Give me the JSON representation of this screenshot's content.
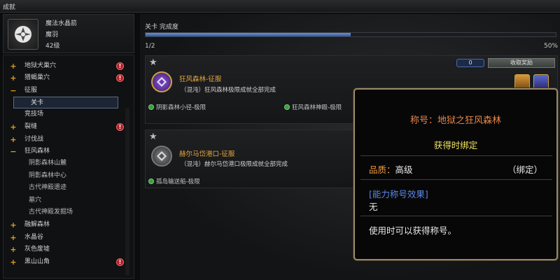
{
  "window": {
    "title": "成就"
  },
  "profile": {
    "name": "魔法水晶箭",
    "title": "魔羽",
    "level": "42级"
  },
  "tree": {
    "items": [
      {
        "label": "地狱犬巢穴",
        "marker": "+",
        "alert": true,
        "kind": "group"
      },
      {
        "label": "猎蝎巢穴",
        "marker": "+",
        "alert": true,
        "kind": "group"
      },
      {
        "label": "征服",
        "marker": "−",
        "alert": false,
        "kind": "group"
      },
      {
        "label": "关卡",
        "marker": "",
        "alert": false,
        "kind": "selected"
      },
      {
        "label": "竞技场",
        "marker": "",
        "alert": false,
        "kind": "group"
      },
      {
        "label": "裂缝",
        "marker": "+",
        "alert": true,
        "kind": "group"
      },
      {
        "label": "讨伐战",
        "marker": "+",
        "alert": false,
        "kind": "group"
      },
      {
        "label": "狂风森林",
        "marker": "−",
        "alert": false,
        "kind": "group"
      },
      {
        "label": "阴影森林山麓",
        "marker": "",
        "alert": false,
        "kind": "child"
      },
      {
        "label": "阴影森林中心",
        "marker": "",
        "alert": false,
        "kind": "child"
      },
      {
        "label": "古代神殿遗迹",
        "marker": "",
        "alert": false,
        "kind": "child"
      },
      {
        "label": "墓穴",
        "marker": "",
        "alert": false,
        "kind": "child"
      },
      {
        "label": "古代神殿发掘场",
        "marker": "",
        "alert": false,
        "kind": "child"
      },
      {
        "label": "融解森林",
        "marker": "+",
        "alert": false,
        "kind": "group"
      },
      {
        "label": "水晶谷",
        "marker": "+",
        "alert": false,
        "kind": "group"
      },
      {
        "label": "灰色废墟",
        "marker": "+",
        "alert": false,
        "kind": "group"
      },
      {
        "label": "黑山山角",
        "marker": "+",
        "alert": true,
        "kind": "group"
      }
    ],
    "alert_glyph": "!"
  },
  "progress": {
    "label": "关卡 完成度",
    "count": "1/2",
    "percent_text": "50%",
    "fraction": 0.5
  },
  "cards": [
    {
      "title": "狂风森林-征服",
      "desc": "（混沌）狂风森林极限成就全部完成",
      "subitems": [
        "阴影森林小径-极限",
        "狂风森林神殿-极限"
      ],
      "count": "0",
      "claim_label": "收取奖励",
      "icon": "purple-emblem-icon"
    },
    {
      "title": "赫尔马岱港口-征服",
      "desc": "（混沌）赫尔马岱港口极限成就全部完成",
      "subitems": [
        "孤岛输送船-极限"
      ],
      "icon": "gray-emblem-icon"
    }
  ],
  "tooltip": {
    "title": "称号：地狱之狂风森林",
    "bind": "获得时绑定",
    "quality_label": "品质：",
    "quality_value": "高级",
    "quality_tag": "（绑定）",
    "effect_title": "[能力称号效果]",
    "effect_value": "无",
    "usage": "使用时可以获得称号。"
  },
  "colors": {
    "accent_orange": "#e8864a",
    "bind_yellow": "#f2e460",
    "effect_blue": "#5a86e8",
    "progress_blue": "#4a70c0"
  }
}
